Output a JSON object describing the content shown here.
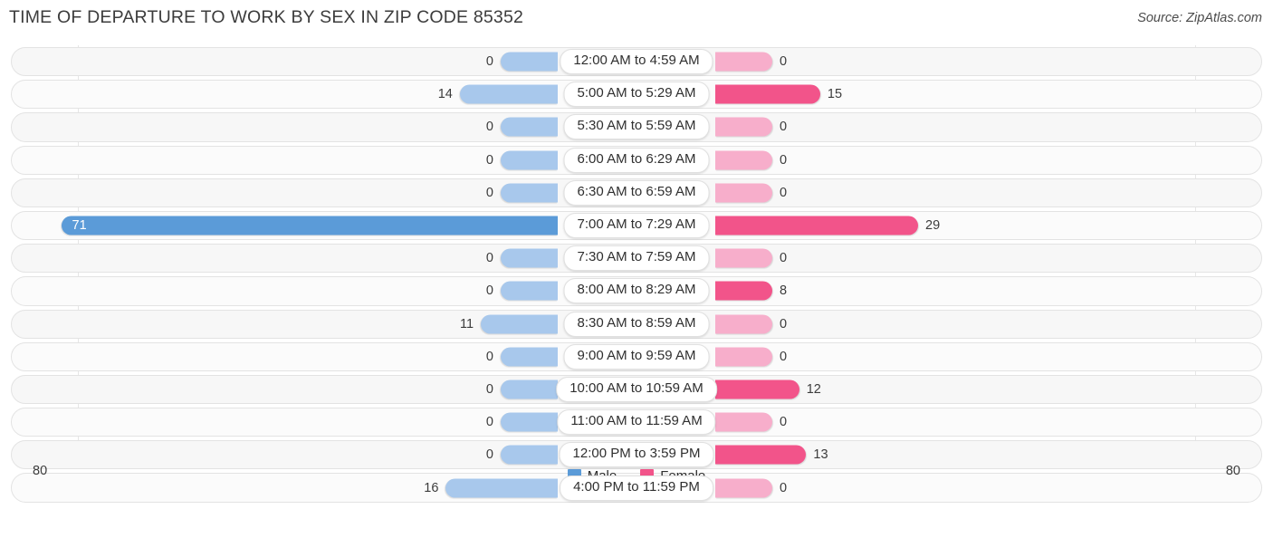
{
  "header": {
    "title": "TIME OF DEPARTURE TO WORK BY SEX IN ZIP CODE 85352",
    "source": "Source: ZipAtlas.com"
  },
  "axis": {
    "left_max": "80",
    "right_max": "80"
  },
  "legend": {
    "items": [
      {
        "label": "Male",
        "color": "#5b9bd8"
      },
      {
        "label": "Female",
        "color": "#f2548a"
      }
    ]
  },
  "colors": {
    "male_light": "#a8c8ec",
    "male_dark": "#5b9bd8",
    "female_light": "#f7aecb",
    "female_dark": "#f2548a",
    "track": "#f7f7f7",
    "text": "#3c3c3c"
  },
  "chart_data": {
    "type": "bar",
    "title": "TIME OF DEPARTURE TO WORK BY SEX IN ZIP CODE 85352",
    "subtitle": "",
    "xlabel": "",
    "ylabel": "",
    "orientation": "horizontal-diverging",
    "xlim": [
      80,
      80
    ],
    "grid": false,
    "legend_position": "bottom-center",
    "categories": [
      "12:00 AM to 4:59 AM",
      "5:00 AM to 5:29 AM",
      "5:30 AM to 5:59 AM",
      "6:00 AM to 6:29 AM",
      "6:30 AM to 6:59 AM",
      "7:00 AM to 7:29 AM",
      "7:30 AM to 7:59 AM",
      "8:00 AM to 8:29 AM",
      "8:30 AM to 8:59 AM",
      "9:00 AM to 9:59 AM",
      "10:00 AM to 10:59 AM",
      "11:00 AM to 11:59 AM",
      "12:00 PM to 3:59 PM",
      "4:00 PM to 11:59 PM"
    ],
    "series": [
      {
        "name": "Male",
        "values": [
          0,
          14,
          0,
          0,
          0,
          71,
          0,
          0,
          11,
          0,
          0,
          0,
          0,
          16
        ]
      },
      {
        "name": "Female",
        "values": [
          0,
          15,
          0,
          0,
          0,
          29,
          0,
          8,
          0,
          0,
          12,
          0,
          13,
          0
        ]
      }
    ]
  },
  "rows": [
    {
      "label": "12:00 AM to 4:59 AM",
      "male": "0",
      "female": "0"
    },
    {
      "label": "5:00 AM to 5:29 AM",
      "male": "14",
      "female": "15"
    },
    {
      "label": "5:30 AM to 5:59 AM",
      "male": "0",
      "female": "0"
    },
    {
      "label": "6:00 AM to 6:29 AM",
      "male": "0",
      "female": "0"
    },
    {
      "label": "6:30 AM to 6:59 AM",
      "male": "0",
      "female": "0"
    },
    {
      "label": "7:00 AM to 7:29 AM",
      "male": "71",
      "female": "29"
    },
    {
      "label": "7:30 AM to 7:59 AM",
      "male": "0",
      "female": "0"
    },
    {
      "label": "8:00 AM to 8:29 AM",
      "male": "0",
      "female": "8"
    },
    {
      "label": "8:30 AM to 8:59 AM",
      "male": "11",
      "female": "0"
    },
    {
      "label": "9:00 AM to 9:59 AM",
      "male": "0",
      "female": "0"
    },
    {
      "label": "10:00 AM to 10:59 AM",
      "male": "0",
      "female": "12"
    },
    {
      "label": "11:00 AM to 11:59 AM",
      "male": "0",
      "female": "0"
    },
    {
      "label": "12:00 PM to 3:59 PM",
      "male": "0",
      "female": "13"
    },
    {
      "label": "4:00 PM to 11:59 PM",
      "male": "16",
      "female": "0"
    }
  ]
}
